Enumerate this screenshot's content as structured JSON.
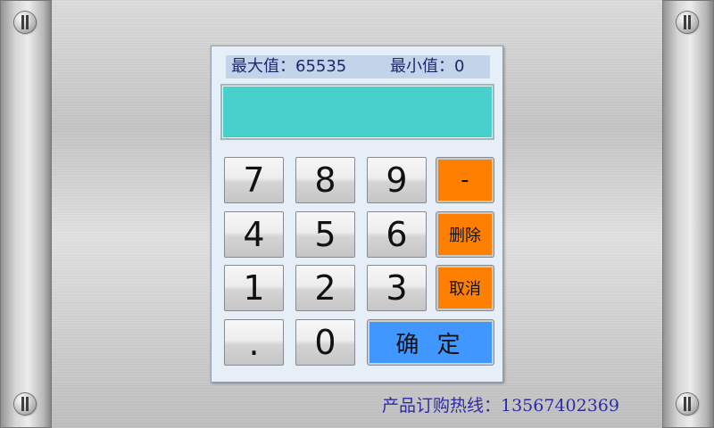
{
  "range": {
    "max_label": "最大值：",
    "max_value": "65535",
    "min_label": "最小值：",
    "min_value": "0"
  },
  "display": {
    "value": ""
  },
  "keypad": {
    "k7": "7",
    "k8": "8",
    "k9": "9",
    "minus": "-",
    "k4": "4",
    "k5": "5",
    "k6": "6",
    "delete": "删除",
    "k1": "1",
    "k2": "2",
    "k3": "3",
    "cancel": "取消",
    "dot": ".",
    "k0": "0",
    "confirm": "确 定"
  },
  "footer": {
    "hotline": "产品订购热线：13567402369"
  },
  "colors": {
    "display_bg": "#48d1cc",
    "action_key": "#ff8000",
    "confirm_key": "#3f97ff",
    "footer_text": "#2e2aa8"
  }
}
